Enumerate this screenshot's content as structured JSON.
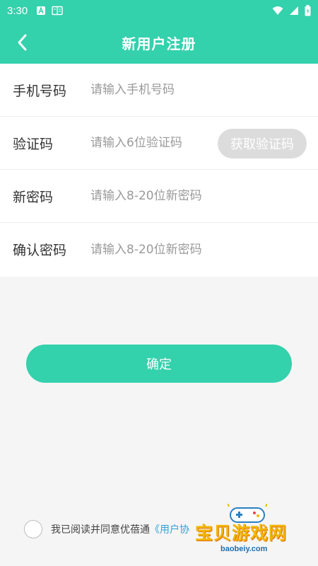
{
  "status_bar": {
    "time": "3:30",
    "icons_left": [
      "a-icon",
      "reader-icon"
    ],
    "icons_right": [
      "wifi-icon",
      "signal-icon",
      "battery-icon"
    ]
  },
  "header": {
    "title": "新用户注册",
    "back_icon": "chevron-left-icon"
  },
  "form": {
    "fields": [
      {
        "label": "手机号码",
        "placeholder": "请输入手机号码",
        "value": ""
      },
      {
        "label": "验证码",
        "placeholder": "请输入6位验证码",
        "value": ""
      },
      {
        "label": "新密码",
        "placeholder": "请输入8-20位新密码",
        "value": ""
      },
      {
        "label": "确认密码",
        "placeholder": "请输入8-20位新密码",
        "value": ""
      }
    ],
    "get_code_label": "获取验证码"
  },
  "confirm_label": "确定",
  "agreement": {
    "checked": false,
    "text": "我已阅读并同意优蓓通",
    "link": "《用户协"
  },
  "watermark": {
    "title": "宝贝游戏网",
    "url": "baobeiy.com"
  },
  "colors": {
    "primary": "#33d1ac",
    "disabled_button": "#dcdcdc",
    "link": "#33a0d8",
    "background": "#f5f5f5"
  }
}
